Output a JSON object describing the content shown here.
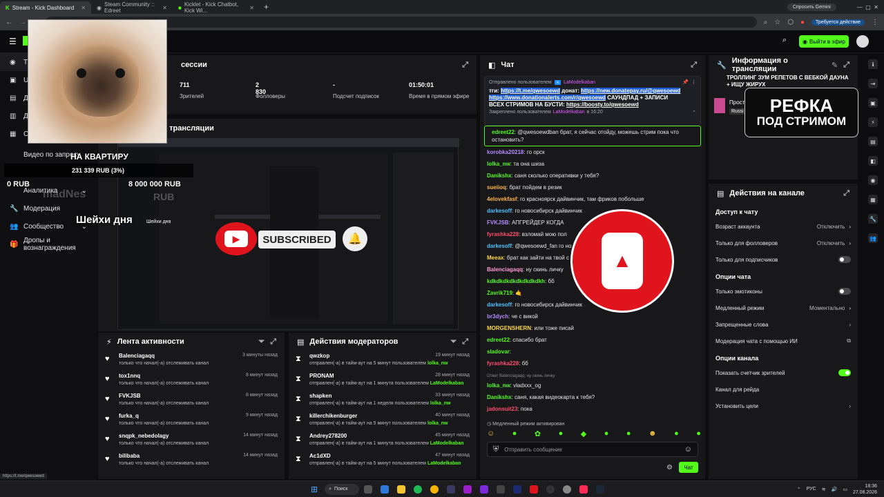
{
  "browser": {
    "tabs": [
      {
        "label": "Stream - Kick Dashboard"
      },
      {
        "label": "Steam Community :: Edreet"
      },
      {
        "label": "Kicklet - Kick Chatbot, Kick Wi..."
      }
    ],
    "ask_gemini": "Спросить Gemini",
    "update_required": "Требуется действие"
  },
  "header": {
    "go_live": "Выйти в эфир"
  },
  "sidebar": {
    "items": [
      {
        "label": "Тр"
      },
      {
        "label": "Ui"
      },
      {
        "label": "Д"
      },
      {
        "label": "Д"
      },
      {
        "label": "С"
      },
      {
        "label": "Видео по запросу"
      },
      {
        "label": "Аналитика"
      },
      {
        "label": "Модерация"
      },
      {
        "label": "Сообщество"
      },
      {
        "label": "Дропы и вознаграждения"
      }
    ]
  },
  "overlay": {
    "goal_title": "НА КВАРТИРУ",
    "goal_amount": "231 339 RUB (3%)",
    "goal_zero": "0 RUB",
    "goal_max": "8 000 000 RUB",
    "neck_day": "Шейхи дня",
    "neck_day_small": "Шейхи дня",
    "donor_ghost": "madNes",
    "donor_ghost_amount": "RUB",
    "subscribed_label": "SUBSCRIBED",
    "refka_line1": "РЕФКА",
    "refka_line2": "ПОД СТРИМОМ"
  },
  "session": {
    "title": "сессии",
    "stats": [
      {
        "value": "711",
        "label": "Зрителей"
      },
      {
        "value": "2 830",
        "label": "Фолловеры"
      },
      {
        "value": "-",
        "label": "Подсчет подписок"
      },
      {
        "value": "01:50:01",
        "label": "Время в прямом эфире"
      }
    ]
  },
  "preview": {
    "title": "тр трансляции"
  },
  "activity": {
    "title": "Лента активности",
    "items": [
      {
        "name": "Balenciagaqq",
        "sub": "только что начал(-а) отслеживать канал",
        "time": "3 минуты назад"
      },
      {
        "name": "tox1nnq",
        "sub": "только что начал(-а) отслеживать канал",
        "time": "8 минут назад"
      },
      {
        "name": "FVKJSB",
        "sub": "только что начал(-а) отслеживать канал",
        "time": "8 минут назад"
      },
      {
        "name": "furka_q",
        "sub": "только что начал(-а) отслеживать канал",
        "time": "9 минут назад"
      },
      {
        "name": "snqpk_nebedolagy",
        "sub": "только что начал(-а) отслеживать канал",
        "time": "14 минут назад"
      },
      {
        "name": "bilibaba",
        "sub": "только что начал(-а) отслеживать канал",
        "time": "14 минут назад"
      }
    ]
  },
  "modactions": {
    "title": "Действия модераторов",
    "items": [
      {
        "name": "qwzkop",
        "sub": "отправлен(-а) в тайм-аут на 5 минут пользователем",
        "by": "lolka_nw",
        "time": "19 минут назад"
      },
      {
        "name": "PRONAM",
        "sub": "отправлен(-а) в тайм-аут на 1 минута пользователем",
        "by": "LaModelkaban",
        "time": "28 минут назад"
      },
      {
        "name": "shapken",
        "sub": "отправлен(-а) в тайм-аут на 1 неделя пользователем",
        "by": "lolka_nw",
        "time": "33 минут назад"
      },
      {
        "name": "killerchikenburger",
        "sub": "отправлен(-а) в тайм-аут на 5 минут пользователем",
        "by": "lolka_nw",
        "time": "40 минут назад"
      },
      {
        "name": "Andrey278200",
        "sub": "отправлен(-а) в тайм-аут на 1 минута пользователем",
        "by": "LaModelkaban",
        "time": "45 минут назад"
      },
      {
        "name": "Ac1dXD",
        "sub": "отправлен(-а) в тайм-аут на 5 минут пользователем",
        "by": "LaModelkaban",
        "time": "47 минут назад"
      }
    ]
  },
  "chat": {
    "title": "Чат",
    "pinned_by_label": "Отправлено пользователем",
    "pinned_by_user": "LaModelkaban",
    "pinned_text_1": "тги:",
    "pinned_link_1": "https://t.me/qwesoewd",
    "pinned_text_2": "донат:",
    "pinned_link_2": "https://new.donatepay.ru/@qwesoewd",
    "pinned_link_3": "https://www.donationalerts.com/r/qwesoewd",
    "pinned_text_3": "САУНДПАД + ЗАПИСИ ВСЕХ СТРИМОВ НА БУСТИ:",
    "pinned_link_4": "https://boosty.to/qwesoewd",
    "pinned_footer": "Закреплено пользователем",
    "pinned_footer_user": "LaModelkaban",
    "pinned_footer_time": "в 16:20",
    "messages": [
      {
        "user": "edreet22",
        "color": "#53fc18",
        "text": "@qwesoewdban брат, я сейчас отойду, можешь стрим пока что остановить?"
      },
      {
        "user": "korobka20218",
        "color": "#b48cff",
        "text": "го орск"
      },
      {
        "user": "lolka_nw",
        "color": "#53fc18",
        "text": "та она шиза"
      },
      {
        "user": "Danikshx",
        "color": "#53fc18",
        "text": "саня сколько оперативки у тебя?"
      },
      {
        "user": "sueiioq",
        "color": "#ffb44a",
        "text": "брат пойдем в резик"
      },
      {
        "user": "4elovekfasf",
        "color": "#ffb44a",
        "text": "го красноярск дайвинчик, там фриков побольше"
      },
      {
        "user": "darkesoff",
        "color": "#4fc3ff",
        "text": "го новосибирск дайвинчик"
      },
      {
        "user": "FVKJSB",
        "color": "#b48cff",
        "text": "АПГРЕЙДЕР КОГДА"
      },
      {
        "user": "fyrashka228",
        "color": "#ff4d6a",
        "text": "взломай мою пол"
      },
      {
        "user": "darkesoff",
        "color": "#4fc3ff",
        "text": "@qwesoewd_fan го но"
      },
      {
        "user": "Meeax",
        "color": "#ffd84a",
        "text": "брат как зайти на твой с"
      },
      {
        "user": "Balenciagaqq",
        "color": "#ff9ad6",
        "text": "ну скинь личку"
      },
      {
        "user": "kdkdkdkdkdkdkdkdkh",
        "color": "#53fc18",
        "text": "бб"
      },
      {
        "user": "Zavrik719",
        "color": "#53fc18",
        "text": "🤙"
      },
      {
        "user": "darkesoff",
        "color": "#4fc3ff",
        "text": "го новосибирск дайвинчик"
      },
      {
        "user": "br3dych",
        "color": "#b48cff",
        "text": "че с викой"
      },
      {
        "user": "MORGENSHERN",
        "color": "#ffd84a",
        "text": "или тоже писай"
      },
      {
        "user": "edreet22",
        "color": "#53fc18",
        "text": "спасибо брат"
      },
      {
        "user": "sladovar",
        "color": "#53fc18",
        "text": ""
      },
      {
        "user": "fyrashka228",
        "color": "#ff4d6a",
        "text": "бб"
      }
    ],
    "reply_note": "Ответ Balenciagaqq: ну скинь личку",
    "messages2": [
      {
        "user": "lolka_nw",
        "color": "#53fc18",
        "text": "vladxxx_og"
      },
      {
        "user": "Danikshx",
        "color": "#53fc18",
        "text": "саня, какая видеокарта к тебя?"
      },
      {
        "user": "jadonsuit23",
        "color": "#ff4d6a",
        "text": "пока"
      }
    ],
    "slow_mode_note": "Медленный режим активирован",
    "input_placeholder": "Отправить сообщение",
    "send_label": "Чат"
  },
  "info": {
    "title": "Информация о трансляции",
    "stream_title": "ТРОЛЛИНГ ЗУМ РЕПЕТОВ С ВЕБКОЙ ДАУНА + ИЩУ ЖИРУХ",
    "category_short": "Прост",
    "lang_badge": "Russi"
  },
  "actions": {
    "title": "Действия на канале",
    "chat_access": "Доступ к чату",
    "rows_access": [
      {
        "label": "Возраст аккаунта",
        "value": "Отключить"
      },
      {
        "label": "Только для фолловеров",
        "value": "Отключить"
      }
    ],
    "subs_only": "Только для подписчиков",
    "chat_options": "Опции чата",
    "emotes_only": "Только эмотиконы",
    "slow_mode": "Медленный режим",
    "slow_mode_value": "Моментально",
    "banned_words": "Запрещенные слова",
    "ai_mod": "Модерация чата с помощью ИИ",
    "channel_options": "Опции канала",
    "show_viewers": "Показать счетчик зрителей",
    "raid_channel": "Канал для рейда",
    "set_goals": "Установить цели"
  },
  "taskbar": {
    "search": "Поиск",
    "lang": "РУС",
    "time": "18:36",
    "date": "27.08.2026"
  },
  "status_url": "https://t.me/qwesoewd",
  "colors": {
    "accent": "#53fc18",
    "bg": "#0d0d0f",
    "panel": "#18181b",
    "youtube_red": "#e0141c"
  }
}
